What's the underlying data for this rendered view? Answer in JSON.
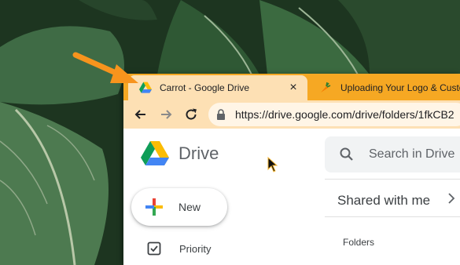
{
  "browser": {
    "active_tab": {
      "title": "Carrot - Google Drive",
      "close": "×"
    },
    "inactive_tab": {
      "title": "Uploading Your Logo & Custo"
    },
    "address": {
      "url": "https://drive.google.com/drive/folders/1fkCB2"
    }
  },
  "drive": {
    "brand": "Drive",
    "search": {
      "placeholder": "Search in Drive"
    },
    "new_button": {
      "label": "New"
    },
    "section": {
      "title": "Shared with me"
    },
    "folders_label": "Folders",
    "sidebar": {
      "items": [
        {
          "label": "Priority",
          "icon": "priority-checkbox-icon"
        }
      ]
    }
  },
  "colors": {
    "tabstrip": "#f6a823",
    "active_tab": "#fde0b4",
    "annotation_arrow": "#f7941d"
  }
}
